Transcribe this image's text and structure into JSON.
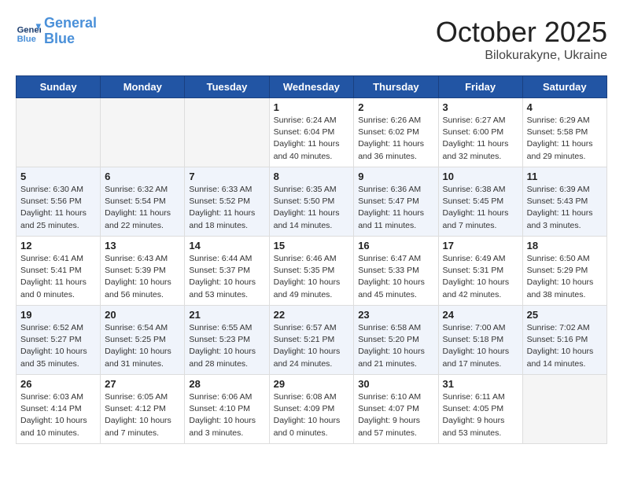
{
  "header": {
    "logo_line1": "General",
    "logo_line2": "Blue",
    "month": "October 2025",
    "location": "Bilokurakyne, Ukraine"
  },
  "weekdays": [
    "Sunday",
    "Monday",
    "Tuesday",
    "Wednesday",
    "Thursday",
    "Friday",
    "Saturday"
  ],
  "weeks": [
    [
      {
        "day": "",
        "info": ""
      },
      {
        "day": "",
        "info": ""
      },
      {
        "day": "",
        "info": ""
      },
      {
        "day": "1",
        "info": "Sunrise: 6:24 AM\nSunset: 6:04 PM\nDaylight: 11 hours\nand 40 minutes."
      },
      {
        "day": "2",
        "info": "Sunrise: 6:26 AM\nSunset: 6:02 PM\nDaylight: 11 hours\nand 36 minutes."
      },
      {
        "day": "3",
        "info": "Sunrise: 6:27 AM\nSunset: 6:00 PM\nDaylight: 11 hours\nand 32 minutes."
      },
      {
        "day": "4",
        "info": "Sunrise: 6:29 AM\nSunset: 5:58 PM\nDaylight: 11 hours\nand 29 minutes."
      }
    ],
    [
      {
        "day": "5",
        "info": "Sunrise: 6:30 AM\nSunset: 5:56 PM\nDaylight: 11 hours\nand 25 minutes."
      },
      {
        "day": "6",
        "info": "Sunrise: 6:32 AM\nSunset: 5:54 PM\nDaylight: 11 hours\nand 22 minutes."
      },
      {
        "day": "7",
        "info": "Sunrise: 6:33 AM\nSunset: 5:52 PM\nDaylight: 11 hours\nand 18 minutes."
      },
      {
        "day": "8",
        "info": "Sunrise: 6:35 AM\nSunset: 5:50 PM\nDaylight: 11 hours\nand 14 minutes."
      },
      {
        "day": "9",
        "info": "Sunrise: 6:36 AM\nSunset: 5:47 PM\nDaylight: 11 hours\nand 11 minutes."
      },
      {
        "day": "10",
        "info": "Sunrise: 6:38 AM\nSunset: 5:45 PM\nDaylight: 11 hours\nand 7 minutes."
      },
      {
        "day": "11",
        "info": "Sunrise: 6:39 AM\nSunset: 5:43 PM\nDaylight: 11 hours\nand 3 minutes."
      }
    ],
    [
      {
        "day": "12",
        "info": "Sunrise: 6:41 AM\nSunset: 5:41 PM\nDaylight: 11 hours\nand 0 minutes."
      },
      {
        "day": "13",
        "info": "Sunrise: 6:43 AM\nSunset: 5:39 PM\nDaylight: 10 hours\nand 56 minutes."
      },
      {
        "day": "14",
        "info": "Sunrise: 6:44 AM\nSunset: 5:37 PM\nDaylight: 10 hours\nand 53 minutes."
      },
      {
        "day": "15",
        "info": "Sunrise: 6:46 AM\nSunset: 5:35 PM\nDaylight: 10 hours\nand 49 minutes."
      },
      {
        "day": "16",
        "info": "Sunrise: 6:47 AM\nSunset: 5:33 PM\nDaylight: 10 hours\nand 45 minutes."
      },
      {
        "day": "17",
        "info": "Sunrise: 6:49 AM\nSunset: 5:31 PM\nDaylight: 10 hours\nand 42 minutes."
      },
      {
        "day": "18",
        "info": "Sunrise: 6:50 AM\nSunset: 5:29 PM\nDaylight: 10 hours\nand 38 minutes."
      }
    ],
    [
      {
        "day": "19",
        "info": "Sunrise: 6:52 AM\nSunset: 5:27 PM\nDaylight: 10 hours\nand 35 minutes."
      },
      {
        "day": "20",
        "info": "Sunrise: 6:54 AM\nSunset: 5:25 PM\nDaylight: 10 hours\nand 31 minutes."
      },
      {
        "day": "21",
        "info": "Sunrise: 6:55 AM\nSunset: 5:23 PM\nDaylight: 10 hours\nand 28 minutes."
      },
      {
        "day": "22",
        "info": "Sunrise: 6:57 AM\nSunset: 5:21 PM\nDaylight: 10 hours\nand 24 minutes."
      },
      {
        "day": "23",
        "info": "Sunrise: 6:58 AM\nSunset: 5:20 PM\nDaylight: 10 hours\nand 21 minutes."
      },
      {
        "day": "24",
        "info": "Sunrise: 7:00 AM\nSunset: 5:18 PM\nDaylight: 10 hours\nand 17 minutes."
      },
      {
        "day": "25",
        "info": "Sunrise: 7:02 AM\nSunset: 5:16 PM\nDaylight: 10 hours\nand 14 minutes."
      }
    ],
    [
      {
        "day": "26",
        "info": "Sunrise: 6:03 AM\nSunset: 4:14 PM\nDaylight: 10 hours\nand 10 minutes."
      },
      {
        "day": "27",
        "info": "Sunrise: 6:05 AM\nSunset: 4:12 PM\nDaylight: 10 hours\nand 7 minutes."
      },
      {
        "day": "28",
        "info": "Sunrise: 6:06 AM\nSunset: 4:10 PM\nDaylight: 10 hours\nand 3 minutes."
      },
      {
        "day": "29",
        "info": "Sunrise: 6:08 AM\nSunset: 4:09 PM\nDaylight: 10 hours\nand 0 minutes."
      },
      {
        "day": "30",
        "info": "Sunrise: 6:10 AM\nSunset: 4:07 PM\nDaylight: 9 hours\nand 57 minutes."
      },
      {
        "day": "31",
        "info": "Sunrise: 6:11 AM\nSunset: 4:05 PM\nDaylight: 9 hours\nand 53 minutes."
      },
      {
        "day": "",
        "info": ""
      }
    ]
  ]
}
